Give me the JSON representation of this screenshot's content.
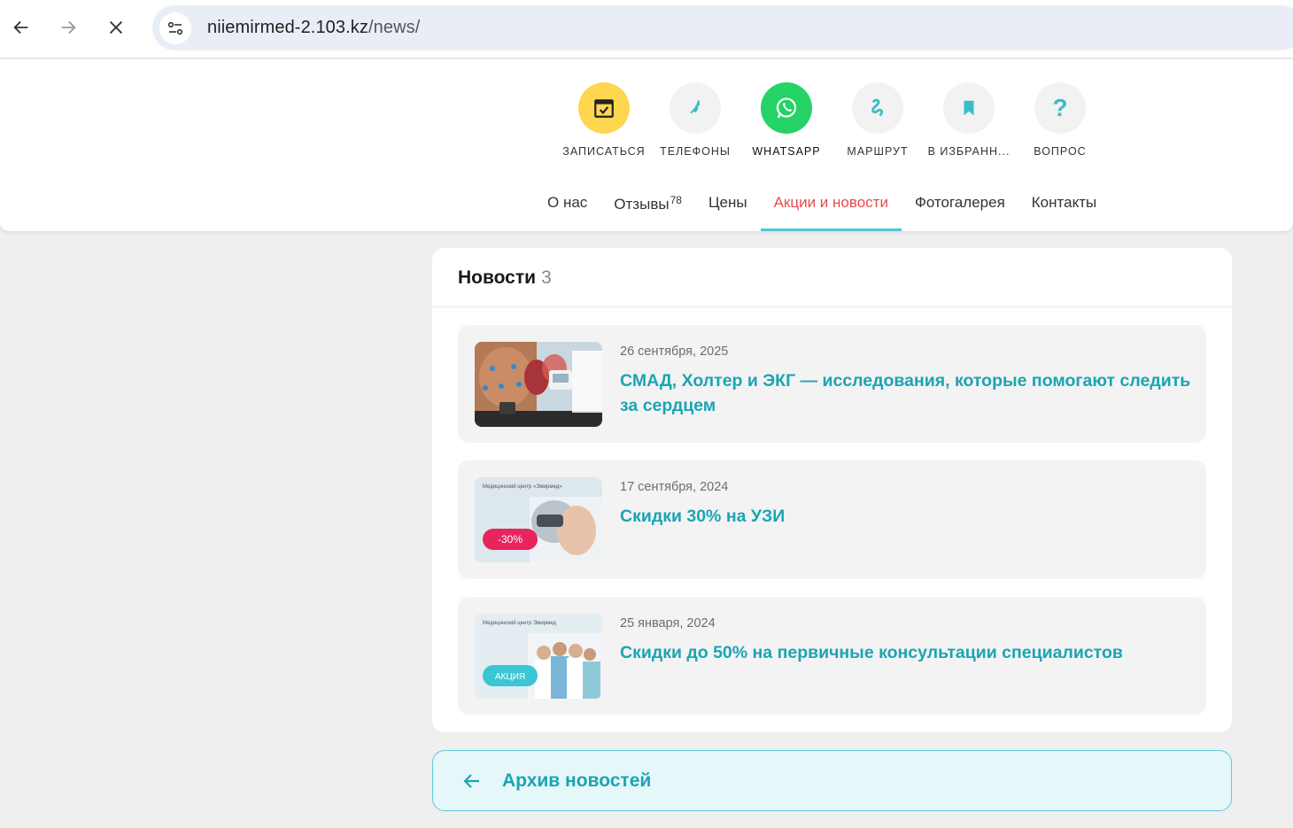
{
  "browser": {
    "url_host": "niiemirmed-2.103.kz",
    "url_path": "/news/"
  },
  "actions": [
    {
      "label": "ЗАПИСАТЬСЯ",
      "icon": "calendar-check-icon",
      "color": "#ffd650"
    },
    {
      "label": "ТЕЛЕФОНЫ",
      "icon": "phone-icon",
      "color": "#f2f2f2"
    },
    {
      "label": "WHATSAPP",
      "icon": "whatsapp-icon",
      "color": "#25d366"
    },
    {
      "label": "МАРШРУТ",
      "icon": "route-icon",
      "color": "#f2f2f2"
    },
    {
      "label": "В ИЗБРАНН...",
      "icon": "bookmark-icon",
      "color": "#f2f2f2"
    },
    {
      "label": "ВОПРОС",
      "icon": "question-icon",
      "color": "#f2f2f2"
    }
  ],
  "tabs": [
    {
      "label": "О нас"
    },
    {
      "label": "Отзывы",
      "badge": "78"
    },
    {
      "label": "Цены"
    },
    {
      "label": "Акции и новости",
      "active": true
    },
    {
      "label": "Фотогалерея"
    },
    {
      "label": "Контакты"
    }
  ],
  "news": {
    "title": "Новости",
    "count": "3",
    "items": [
      {
        "date": "26 сентября, 2025",
        "title": "СМАД, Холтер и ЭКГ — исследования, которые помогают следить за сердцем"
      },
      {
        "date": "17 сентября, 2024",
        "title": "Скидки 30% на УЗИ",
        "thumb_small_text": "Медицинский центр «Эмирмед»",
        "thumb_badge": "-30%"
      },
      {
        "date": "25 января, 2024",
        "title": "Скидки до 50% на первичные консультации специалистов",
        "thumb_small_text": "Медицинский центр Эмирмед",
        "thumb_badge": "АКЦИЯ"
      }
    ]
  },
  "archive": {
    "label": "Архив новостей"
  },
  "colors": {
    "accent": "#1aa5b3",
    "active_tab": "#e64b4b",
    "tab_underline": "#4fc6d0"
  }
}
